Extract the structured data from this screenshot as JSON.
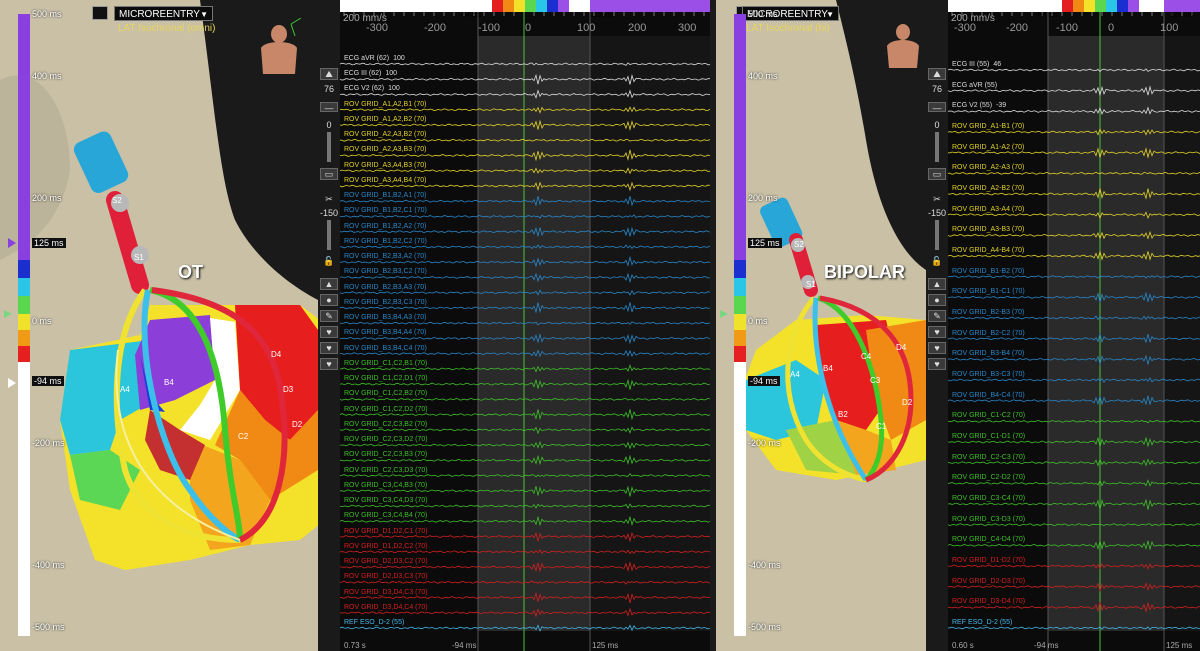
{
  "colors": {
    "yellow": "#e3d22a",
    "blue": "#2a86c8",
    "green": "#3fbf2a",
    "red": "#d42020",
    "white": "#dcdcdc",
    "cyan": "#45b6e6",
    "scale_purple": "#8a3fe0"
  },
  "scale": {
    "labels": [
      "500 ms",
      "400 ms",
      "200 ms",
      "125 ms",
      "0 ms",
      "-94 ms",
      "-200 ms",
      "-400 ms",
      "-500 ms"
    ]
  },
  "left": {
    "dropdown": "MICROREENTRY",
    "sublabel": "LAT Isochronal (omni)",
    "map_label": "OT",
    "electrodes": [
      "S2",
      "S1",
      "A4",
      "B4",
      "C4",
      "D4",
      "D3",
      "D2",
      "C2"
    ],
    "toolbar": {
      "num1": "76",
      "num2": "0",
      "num3": "-150"
    },
    "speed": "200 mm/s",
    "axis": [
      "-300",
      "-200",
      "-100",
      "0",
      "100",
      "200",
      "300"
    ],
    "marker_left": "-94 ms",
    "marker_right": "125 ms",
    "bottom": {
      "time": "0.73 s",
      "m1": "-94 ms",
      "m2": "125 ms"
    },
    "channels": [
      {
        "label": "ECG aVR (62)",
        "gain": "100",
        "group": "white"
      },
      {
        "label": "ECG III (62)",
        "gain": "100",
        "group": "white"
      },
      {
        "label": "ECG V2 (62)",
        "gain": "100",
        "group": "white"
      },
      {
        "label": "ROV GRID_A1,A2,B1 (70)",
        "gain": "",
        "group": "yellow"
      },
      {
        "label": "ROV GRID_A1,A2,B2 (70)",
        "gain": "",
        "group": "yellow"
      },
      {
        "label": "ROV GRID_A2,A3,B2 (70)",
        "gain": "",
        "group": "yellow"
      },
      {
        "label": "ROV GRID_A2,A3,B3 (70)",
        "gain": "",
        "group": "yellow"
      },
      {
        "label": "ROV GRID_A3,A4,B3 (70)",
        "gain": "",
        "group": "yellow"
      },
      {
        "label": "ROV GRID_A3,A4,B4 (70)",
        "gain": "",
        "group": "yellow"
      },
      {
        "label": "ROV GRID_B1,B2,A1 (70)",
        "gain": "",
        "group": "blue"
      },
      {
        "label": "ROV GRID_B1,B2,C1 (70)",
        "gain": "",
        "group": "blue"
      },
      {
        "label": "ROV GRID_B1,B2,A2 (70)",
        "gain": "",
        "group": "blue"
      },
      {
        "label": "ROV GRID_B1,B2,C2 (70)",
        "gain": "",
        "group": "blue"
      },
      {
        "label": "ROV GRID_B2,B3,A2 (70)",
        "gain": "",
        "group": "blue"
      },
      {
        "label": "ROV GRID_B2,B3,C2 (70)",
        "gain": "",
        "group": "blue"
      },
      {
        "label": "ROV GRID_B2,B3,A3 (70)",
        "gain": "",
        "group": "blue"
      },
      {
        "label": "ROV GRID_B2,B3,C3 (70)",
        "gain": "",
        "group": "blue"
      },
      {
        "label": "ROV GRID_B3,B4,A3 (70)",
        "gain": "",
        "group": "blue"
      },
      {
        "label": "ROV GRID_B3,B4,A4 (70)",
        "gain": "",
        "group": "blue"
      },
      {
        "label": "ROV GRID_B3,B4,C4 (70)",
        "gain": "",
        "group": "blue"
      },
      {
        "label": "ROV GRID_C1,C2,B1 (70)",
        "gain": "",
        "group": "green"
      },
      {
        "label": "ROV GRID_C1,C2,D1 (70)",
        "gain": "",
        "group": "green"
      },
      {
        "label": "ROV GRID_C1,C2,B2 (70)",
        "gain": "",
        "group": "green"
      },
      {
        "label": "ROV GRID_C1,C2,D2 (70)",
        "gain": "",
        "group": "green"
      },
      {
        "label": "ROV GRID_C2,C3,B2 (70)",
        "gain": "",
        "group": "green"
      },
      {
        "label": "ROV GRID_C2,C3,D2 (70)",
        "gain": "",
        "group": "green"
      },
      {
        "label": "ROV GRID_C2,C3,B3 (70)",
        "gain": "",
        "group": "green"
      },
      {
        "label": "ROV GRID_C2,C3,D3 (70)",
        "gain": "",
        "group": "green"
      },
      {
        "label": "ROV GRID_C3,C4,B3 (70)",
        "gain": "",
        "group": "green"
      },
      {
        "label": "ROV GRID_C3,C4,D3 (70)",
        "gain": "",
        "group": "green"
      },
      {
        "label": "ROV GRID_C3,C4,B4 (70)",
        "gain": "",
        "group": "green"
      },
      {
        "label": "ROV GRID_D1,D2,C1 (70)",
        "gain": "",
        "group": "red"
      },
      {
        "label": "ROV GRID_D1,D2,C2 (70)",
        "gain": "",
        "group": "red"
      },
      {
        "label": "ROV GRID_D2,D3,C2 (70)",
        "gain": "",
        "group": "red"
      },
      {
        "label": "ROV GRID_D2,D3,C3 (70)",
        "gain": "",
        "group": "red"
      },
      {
        "label": "ROV GRID_D3,D4,C3 (70)",
        "gain": "",
        "group": "red"
      },
      {
        "label": "ROV GRID_D3,D4,C4 (70)",
        "gain": "",
        "group": "red"
      },
      {
        "label": "REF ESO_D-2 (55)",
        "gain": "",
        "group": "cyan"
      }
    ]
  },
  "right": {
    "dropdown": "MICROREENTRY",
    "sublabel": "LAT Isochronal (bi)",
    "map_label": "BIPOLAR",
    "electrodes": [
      "S2",
      "S1",
      "A4",
      "B4",
      "C4",
      "D4",
      "C3",
      "B2",
      "C1",
      "D2"
    ],
    "toolbar": {
      "num1": "76",
      "num2": "0",
      "num3": "-150"
    },
    "speed": "200 mm/s",
    "axis": [
      "-300",
      "-200",
      "-100",
      "0",
      "100"
    ],
    "marker_left": "-94 ms",
    "marker_right": "125 ms",
    "bottom": {
      "time": "0.60 s",
      "m1": "-94 ms",
      "m2": "125 ms"
    },
    "channels": [
      {
        "label": "ECG III (55)",
        "gain": "46",
        "group": "white"
      },
      {
        "label": "ECG aVR (55)",
        "gain": "",
        "group": "white"
      },
      {
        "label": "ECG V2 (55)",
        "gain": "-39",
        "group": "white"
      },
      {
        "label": "ROV GRID_A1-B1 (70)",
        "gain": "",
        "group": "yellow"
      },
      {
        "label": "ROV GRID_A1-A2 (70)",
        "gain": "",
        "group": "yellow"
      },
      {
        "label": "ROV GRID_A2-A3 (70)",
        "gain": "",
        "group": "yellow"
      },
      {
        "label": "ROV GRID_A2-B2 (70)",
        "gain": "",
        "group": "yellow"
      },
      {
        "label": "ROV GRID_A3-A4 (70)",
        "gain": "",
        "group": "yellow"
      },
      {
        "label": "ROV GRID_A3-B3 (70)",
        "gain": "",
        "group": "yellow"
      },
      {
        "label": "ROV GRID_A4-B4 (70)",
        "gain": "",
        "group": "yellow"
      },
      {
        "label": "ROV GRID_B1-B2 (70)",
        "gain": "",
        "group": "blue"
      },
      {
        "label": "ROV GRID_B1-C1 (70)",
        "gain": "",
        "group": "blue"
      },
      {
        "label": "ROV GRID_B2-B3 (70)",
        "gain": "",
        "group": "blue"
      },
      {
        "label": "ROV GRID_B2-C2 (70)",
        "gain": "",
        "group": "blue"
      },
      {
        "label": "ROV GRID_B3-B4 (70)",
        "gain": "",
        "group": "blue"
      },
      {
        "label": "ROV GRID_B3-C3 (70)",
        "gain": "",
        "group": "blue"
      },
      {
        "label": "ROV GRID_B4-C4 (70)",
        "gain": "",
        "group": "blue"
      },
      {
        "label": "ROV GRID_C1-C2 (70)",
        "gain": "",
        "group": "green"
      },
      {
        "label": "ROV GRID_C1-D1 (70)",
        "gain": "",
        "group": "green"
      },
      {
        "label": "ROV GRID_C2-C3 (70)",
        "gain": "",
        "group": "green"
      },
      {
        "label": "ROV GRID_C2-D2 (70)",
        "gain": "",
        "group": "green"
      },
      {
        "label": "ROV GRID_C3-C4 (70)",
        "gain": "",
        "group": "green"
      },
      {
        "label": "ROV GRID_C3-D3 (70)",
        "gain": "",
        "group": "green"
      },
      {
        "label": "ROV GRID_C4-D4 (70)",
        "gain": "",
        "group": "green"
      },
      {
        "label": "ROV GRID_D1-D2 (70)",
        "gain": "",
        "group": "red"
      },
      {
        "label": "ROV GRID_D2-D3 (70)",
        "gain": "",
        "group": "red"
      },
      {
        "label": "ROV GRID_D3-D4 (70)",
        "gain": "",
        "group": "red"
      },
      {
        "label": "REF ESO_D-2 (55)",
        "gain": "",
        "group": "cyan"
      }
    ]
  }
}
